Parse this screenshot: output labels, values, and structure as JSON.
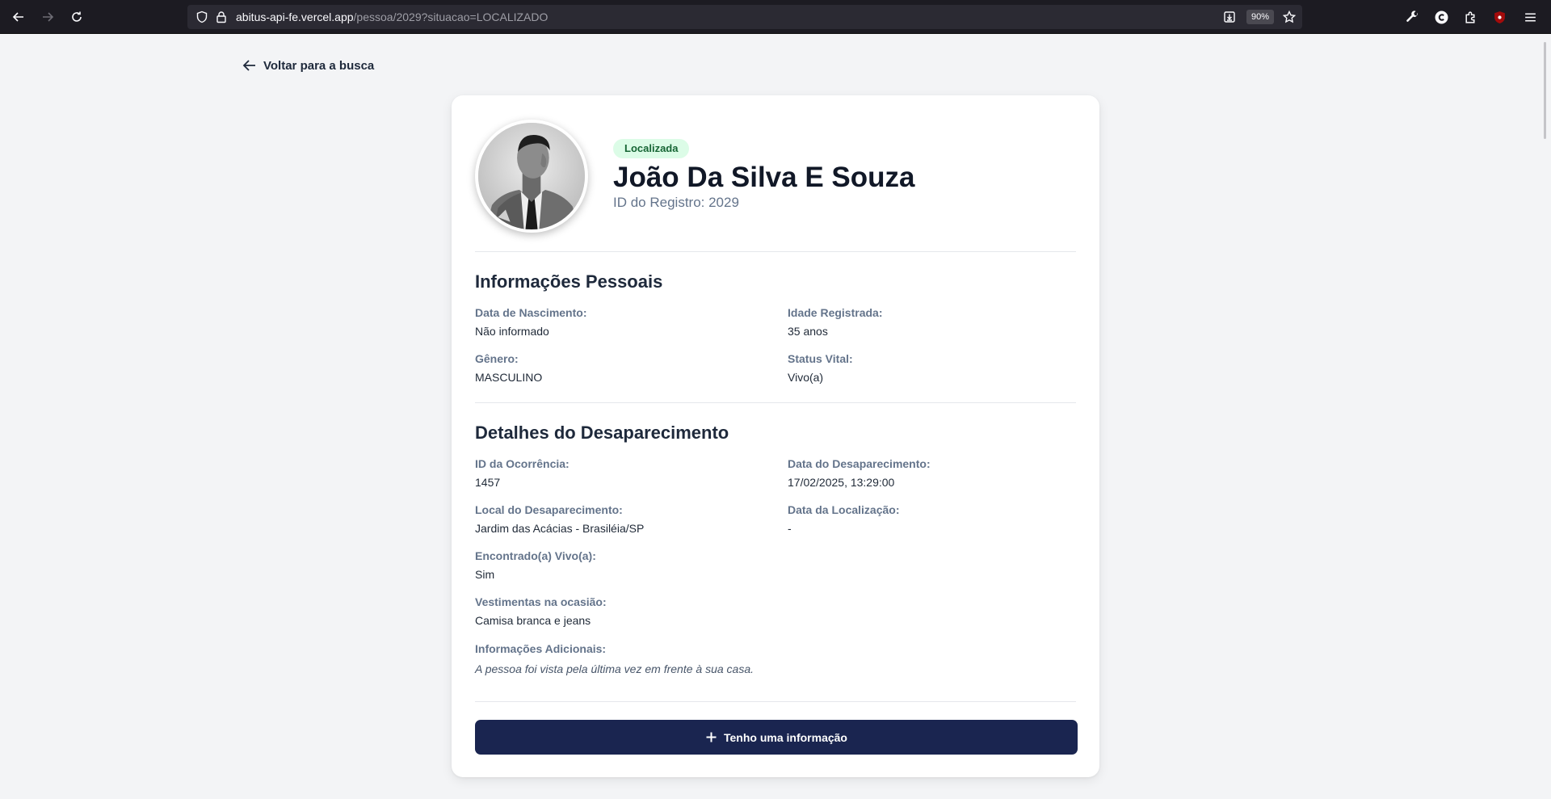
{
  "browser": {
    "url_host": "abitus-api-fe.vercel.app",
    "url_path": "/pessoa/2029?situacao=LOCALIZADO",
    "zoom": "90%"
  },
  "page": {
    "back_label": "Voltar para a busca"
  },
  "person": {
    "status_badge": "Localizada",
    "name": "João Da Silva E Souza",
    "record_id": "ID do Registro: 2029"
  },
  "personal_info": {
    "title": "Informações Pessoais",
    "birth_date_label": "Data de Nascimento:",
    "birth_date_value": "Não informado",
    "age_label": "Idade Registrada:",
    "age_value": "35 anos",
    "gender_label": "Gênero:",
    "gender_value": "MASCULINO",
    "vital_label": "Status Vital:",
    "vital_value": "Vivo(a)"
  },
  "disappearance": {
    "title": "Detalhes do Desaparecimento",
    "occurrence_label": "ID da Ocorrência:",
    "occurrence_value": "1457",
    "date_label": "Data do Desaparecimento:",
    "date_value": "17/02/2025, 13:29:00",
    "place_label": "Local do Desaparecimento:",
    "place_value": "Jardim das Acácias - Brasiléia/SP",
    "found_date_label": "Data da Localização:",
    "found_date_value": "-",
    "found_alive_label": "Encontrado(a) Vivo(a):",
    "found_alive_value": "Sim",
    "clothes_label": "Vestimentas na ocasião:",
    "clothes_value": "Camisa branca e jeans",
    "additional_label": "Informações Adicionais:",
    "additional_value": "A pessoa foi vista pela última vez em frente à sua casa."
  },
  "cta": {
    "label": "Tenho uma informação"
  },
  "colors": {
    "primary": "#1a2550",
    "badge_bg": "#dcfce7",
    "badge_text": "#166534",
    "page_bg": "#f3f4f6"
  }
}
